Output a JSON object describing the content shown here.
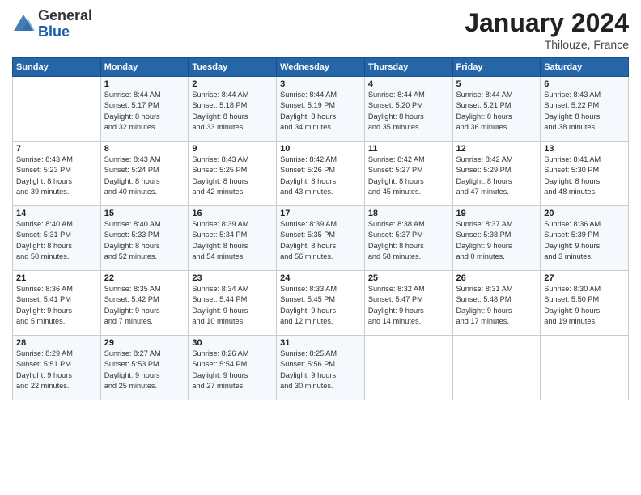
{
  "logo": {
    "general": "General",
    "blue": "Blue"
  },
  "header": {
    "month": "January 2024",
    "location": "Thilouze, France"
  },
  "weekdays": [
    "Sunday",
    "Monday",
    "Tuesday",
    "Wednesday",
    "Thursday",
    "Friday",
    "Saturday"
  ],
  "weeks": [
    [
      {
        "day": "",
        "sunrise": "",
        "sunset": "",
        "daylight": ""
      },
      {
        "day": "1",
        "sunrise": "Sunrise: 8:44 AM",
        "sunset": "Sunset: 5:17 PM",
        "daylight": "Daylight: 8 hours and 32 minutes."
      },
      {
        "day": "2",
        "sunrise": "Sunrise: 8:44 AM",
        "sunset": "Sunset: 5:18 PM",
        "daylight": "Daylight: 8 hours and 33 minutes."
      },
      {
        "day": "3",
        "sunrise": "Sunrise: 8:44 AM",
        "sunset": "Sunset: 5:19 PM",
        "daylight": "Daylight: 8 hours and 34 minutes."
      },
      {
        "day": "4",
        "sunrise": "Sunrise: 8:44 AM",
        "sunset": "Sunset: 5:20 PM",
        "daylight": "Daylight: 8 hours and 35 minutes."
      },
      {
        "day": "5",
        "sunrise": "Sunrise: 8:44 AM",
        "sunset": "Sunset: 5:21 PM",
        "daylight": "Daylight: 8 hours and 36 minutes."
      },
      {
        "day": "6",
        "sunrise": "Sunrise: 8:43 AM",
        "sunset": "Sunset: 5:22 PM",
        "daylight": "Daylight: 8 hours and 38 minutes."
      }
    ],
    [
      {
        "day": "7",
        "sunrise": "Sunrise: 8:43 AM",
        "sunset": "Sunset: 5:23 PM",
        "daylight": "Daylight: 8 hours and 39 minutes."
      },
      {
        "day": "8",
        "sunrise": "Sunrise: 8:43 AM",
        "sunset": "Sunset: 5:24 PM",
        "daylight": "Daylight: 8 hours and 40 minutes."
      },
      {
        "day": "9",
        "sunrise": "Sunrise: 8:43 AM",
        "sunset": "Sunset: 5:25 PM",
        "daylight": "Daylight: 8 hours and 42 minutes."
      },
      {
        "day": "10",
        "sunrise": "Sunrise: 8:42 AM",
        "sunset": "Sunset: 5:26 PM",
        "daylight": "Daylight: 8 hours and 43 minutes."
      },
      {
        "day": "11",
        "sunrise": "Sunrise: 8:42 AM",
        "sunset": "Sunset: 5:27 PM",
        "daylight": "Daylight: 8 hours and 45 minutes."
      },
      {
        "day": "12",
        "sunrise": "Sunrise: 8:42 AM",
        "sunset": "Sunset: 5:29 PM",
        "daylight": "Daylight: 8 hours and 47 minutes."
      },
      {
        "day": "13",
        "sunrise": "Sunrise: 8:41 AM",
        "sunset": "Sunset: 5:30 PM",
        "daylight": "Daylight: 8 hours and 48 minutes."
      }
    ],
    [
      {
        "day": "14",
        "sunrise": "Sunrise: 8:40 AM",
        "sunset": "Sunset: 5:31 PM",
        "daylight": "Daylight: 8 hours and 50 minutes."
      },
      {
        "day": "15",
        "sunrise": "Sunrise: 8:40 AM",
        "sunset": "Sunset: 5:33 PM",
        "daylight": "Daylight: 8 hours and 52 minutes."
      },
      {
        "day": "16",
        "sunrise": "Sunrise: 8:39 AM",
        "sunset": "Sunset: 5:34 PM",
        "daylight": "Daylight: 8 hours and 54 minutes."
      },
      {
        "day": "17",
        "sunrise": "Sunrise: 8:39 AM",
        "sunset": "Sunset: 5:35 PM",
        "daylight": "Daylight: 8 hours and 56 minutes."
      },
      {
        "day": "18",
        "sunrise": "Sunrise: 8:38 AM",
        "sunset": "Sunset: 5:37 PM",
        "daylight": "Daylight: 8 hours and 58 minutes."
      },
      {
        "day": "19",
        "sunrise": "Sunrise: 8:37 AM",
        "sunset": "Sunset: 5:38 PM",
        "daylight": "Daylight: 9 hours and 0 minutes."
      },
      {
        "day": "20",
        "sunrise": "Sunrise: 8:36 AM",
        "sunset": "Sunset: 5:39 PM",
        "daylight": "Daylight: 9 hours and 3 minutes."
      }
    ],
    [
      {
        "day": "21",
        "sunrise": "Sunrise: 8:36 AM",
        "sunset": "Sunset: 5:41 PM",
        "daylight": "Daylight: 9 hours and 5 minutes."
      },
      {
        "day": "22",
        "sunrise": "Sunrise: 8:35 AM",
        "sunset": "Sunset: 5:42 PM",
        "daylight": "Daylight: 9 hours and 7 minutes."
      },
      {
        "day": "23",
        "sunrise": "Sunrise: 8:34 AM",
        "sunset": "Sunset: 5:44 PM",
        "daylight": "Daylight: 9 hours and 10 minutes."
      },
      {
        "day": "24",
        "sunrise": "Sunrise: 8:33 AM",
        "sunset": "Sunset: 5:45 PM",
        "daylight": "Daylight: 9 hours and 12 minutes."
      },
      {
        "day": "25",
        "sunrise": "Sunrise: 8:32 AM",
        "sunset": "Sunset: 5:47 PM",
        "daylight": "Daylight: 9 hours and 14 minutes."
      },
      {
        "day": "26",
        "sunrise": "Sunrise: 8:31 AM",
        "sunset": "Sunset: 5:48 PM",
        "daylight": "Daylight: 9 hours and 17 minutes."
      },
      {
        "day": "27",
        "sunrise": "Sunrise: 8:30 AM",
        "sunset": "Sunset: 5:50 PM",
        "daylight": "Daylight: 9 hours and 19 minutes."
      }
    ],
    [
      {
        "day": "28",
        "sunrise": "Sunrise: 8:29 AM",
        "sunset": "Sunset: 5:51 PM",
        "daylight": "Daylight: 9 hours and 22 minutes."
      },
      {
        "day": "29",
        "sunrise": "Sunrise: 8:27 AM",
        "sunset": "Sunset: 5:53 PM",
        "daylight": "Daylight: 9 hours and 25 minutes."
      },
      {
        "day": "30",
        "sunrise": "Sunrise: 8:26 AM",
        "sunset": "Sunset: 5:54 PM",
        "daylight": "Daylight: 9 hours and 27 minutes."
      },
      {
        "day": "31",
        "sunrise": "Sunrise: 8:25 AM",
        "sunset": "Sunset: 5:56 PM",
        "daylight": "Daylight: 9 hours and 30 minutes."
      },
      {
        "day": "",
        "sunrise": "",
        "sunset": "",
        "daylight": ""
      },
      {
        "day": "",
        "sunrise": "",
        "sunset": "",
        "daylight": ""
      },
      {
        "day": "",
        "sunrise": "",
        "sunset": "",
        "daylight": ""
      }
    ]
  ]
}
